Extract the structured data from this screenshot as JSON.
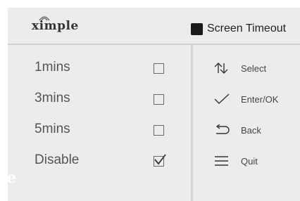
{
  "header": {
    "logo_text": "ximple",
    "title": "Screen Timeout"
  },
  "options": [
    {
      "label": "1mins",
      "checked": false
    },
    {
      "label": "3mins",
      "checked": false
    },
    {
      "label": "5mins",
      "checked": false
    },
    {
      "label": "Disable",
      "checked": true
    }
  ],
  "hints": [
    {
      "label": "Select",
      "icon": "up-down-arrows-icon"
    },
    {
      "label": "Enter/OK",
      "icon": "checkmark-icon"
    },
    {
      "label": "Back",
      "icon": "back-arrow-icon"
    },
    {
      "label": "Quit",
      "icon": "menu-lines-icon"
    }
  ],
  "watermark_text": "le",
  "colors": {
    "panel": "#ececec",
    "divider": "#d6d6d6",
    "text": "#555555"
  }
}
